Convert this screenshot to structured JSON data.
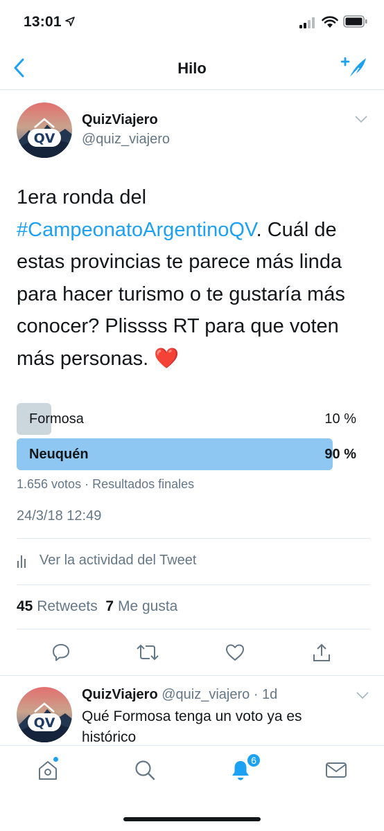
{
  "status_bar": {
    "time": "13:01"
  },
  "nav": {
    "title": "Hilo"
  },
  "tweet": {
    "author_name": "QuizViajero",
    "author_handle": "@quiz_viajero",
    "text_before": "1era ronda del ",
    "hashtag": "#CampeonatoArgentinoQV",
    "text_after": ". Cuál de estas provincias te parece más linda para hacer turismo o te gustaría más conocer? Plissss RT para que voten más personas. ",
    "emoji": "❤️",
    "poll": {
      "options": [
        {
          "label": "Formosa",
          "percent_label": "10 %",
          "percent": 10
        },
        {
          "label": "Neuquén",
          "percent_label": "90 %",
          "percent": 90
        }
      ],
      "meta": "1.656 votos · Resultados finales"
    },
    "timestamp": "24/3/18 12:49",
    "activity_label": "Ver la actividad del Tweet",
    "stats": {
      "retweets_count": "45",
      "retweets_label": "Retweets",
      "likes_count": "7",
      "likes_label": "Me gusta"
    }
  },
  "reply": {
    "author_name": "QuizViajero",
    "author_handle": "@quiz_viajero",
    "separator": " · ",
    "time": "1d",
    "text": "Qué Formosa tenga un voto ya es histórico"
  },
  "tab_bar": {
    "notifications_badge": "6"
  },
  "avatar_text": "QV",
  "colors": {
    "accent": "#1da1f2",
    "poll_winner": "#8ec7f2",
    "poll_loser": "#ccd6dd",
    "secondary_text": "#657786",
    "heart": "#e0245e"
  },
  "icons": [
    "location-arrow-icon",
    "signal-icon",
    "wifi-icon",
    "battery-icon",
    "back-chevron-icon",
    "compose-icon",
    "chevron-down-icon",
    "activity-bars-icon",
    "reply-icon",
    "retweet-icon",
    "like-icon",
    "share-icon",
    "home-icon",
    "search-icon",
    "notifications-icon",
    "messages-icon"
  ]
}
